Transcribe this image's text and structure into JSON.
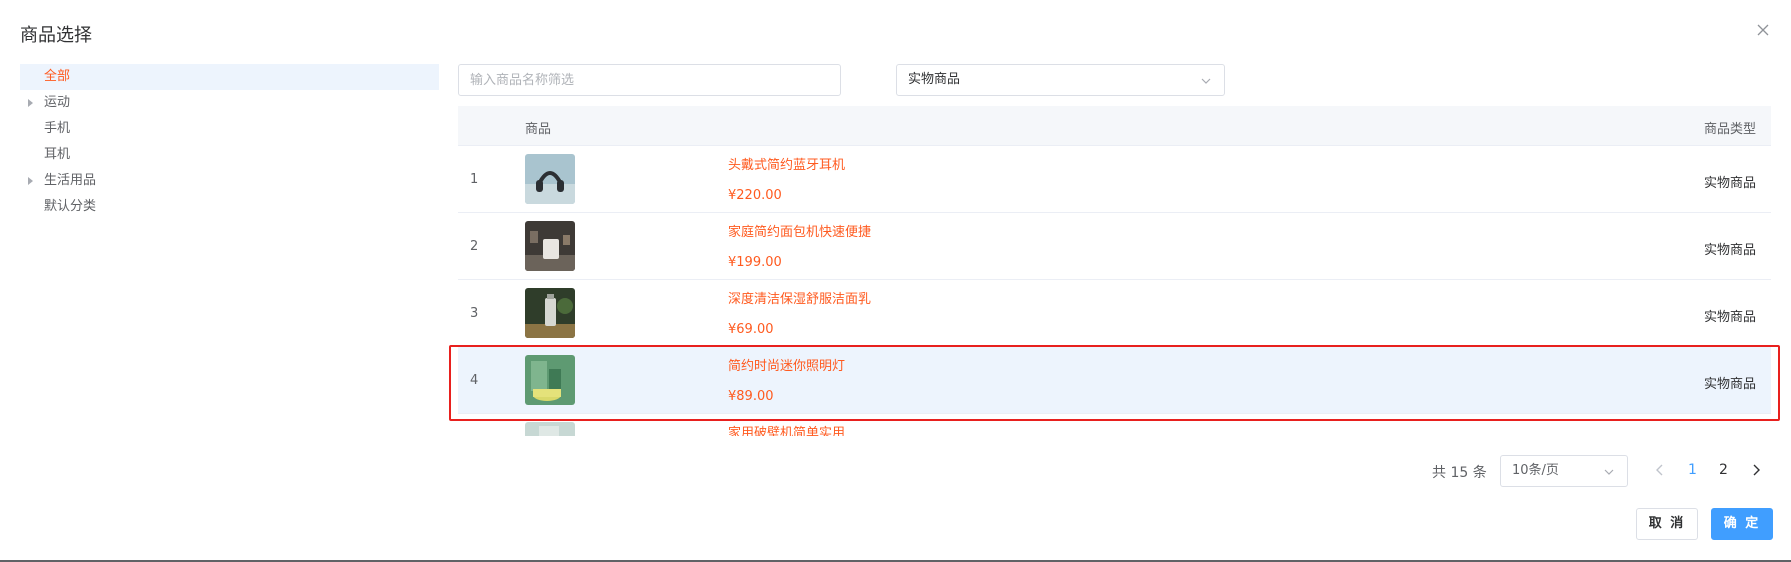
{
  "dialog": {
    "title": "商品选择"
  },
  "tree": {
    "items": [
      {
        "label": "全部",
        "active": true,
        "expandable": false
      },
      {
        "label": "运动",
        "active": false,
        "expandable": true
      },
      {
        "label": "手机",
        "active": false,
        "expandable": false
      },
      {
        "label": "耳机",
        "active": false,
        "expandable": false
      },
      {
        "label": "生活用品",
        "active": false,
        "expandable": true
      },
      {
        "label": "默认分类",
        "active": false,
        "expandable": false
      }
    ]
  },
  "filters": {
    "search_placeholder": "输入商品名称筛选",
    "type_selected": "实物商品"
  },
  "table": {
    "headers": {
      "product": "商品",
      "type": "商品类型"
    },
    "rows": [
      {
        "index": "1",
        "name": "头戴式简约蓝牙耳机",
        "price": "¥220.00",
        "type": "实物商品"
      },
      {
        "index": "2",
        "name": "家庭简约面包机快速便捷",
        "price": "¥199.00",
        "type": "实物商品"
      },
      {
        "index": "3",
        "name": "深度清洁保湿舒服洁面乳",
        "price": "¥69.00",
        "type": "实物商品"
      },
      {
        "index": "4",
        "name": "简约时尚迷你照明灯",
        "price": "¥89.00",
        "type": "实物商品"
      },
      {
        "index": "",
        "name": "家用破壁机简单实用",
        "price": "",
        "type": ""
      }
    ]
  },
  "pagination": {
    "total_text": "共 15 条",
    "page_size": "10条/页",
    "pages": [
      "1",
      "2"
    ],
    "current_page": "1"
  },
  "buttons": {
    "cancel": "取 消",
    "ok": "确 定"
  },
  "colors": {
    "accent": "#409eff",
    "price": "#ff5a1f",
    "selection": "#e8201e",
    "row_highlight": "#edf4fd"
  }
}
